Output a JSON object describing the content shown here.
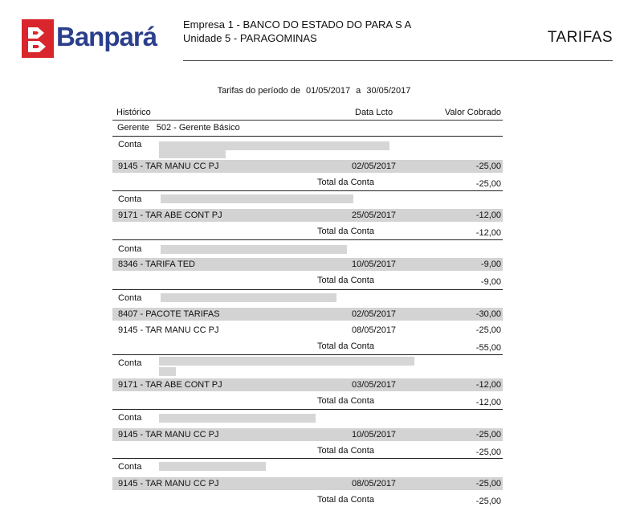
{
  "header": {
    "brand_name": "Banpará",
    "company_label": "Empresa 1",
    "company_name": "BANCO DO ESTADO DO PARA S A",
    "unit_label": "Unidade 5",
    "unit_name": "PARAGOMINAS",
    "report_title": "TARIFAS"
  },
  "period": {
    "prefix": "Tarifas do período de",
    "start": "01/05/2017",
    "connector": "a",
    "end": "30/05/2017"
  },
  "columns": {
    "historico": "Histórico",
    "data_lcto": "Data Lcto",
    "valor_cobrado": "Valor Cobrado"
  },
  "gerente": {
    "label": "Gerente",
    "value": "502 - Gerente Básico"
  },
  "account_label": "Conta",
  "total_label": "Total da Conta",
  "accounts": [
    {
      "transactions": [
        {
          "code": "9145 - TAR MANU CC PJ",
          "date": "02/05/2017",
          "value": "-25,00"
        }
      ],
      "total": "-25,00"
    },
    {
      "transactions": [
        {
          "code": "9171 - TAR ABE CONT PJ",
          "date": "25/05/2017",
          "value": "-12,00"
        }
      ],
      "total": "-12,00"
    },
    {
      "transactions": [
        {
          "code": "8346 - TARIFA TED",
          "date": "10/05/2017",
          "value": "-9,00"
        }
      ],
      "total": "-9,00"
    },
    {
      "transactions": [
        {
          "code": "8407 - PACOTE TARIFAS",
          "date": "02/05/2017",
          "value": "-30,00"
        },
        {
          "code": "9145 - TAR MANU CC PJ",
          "date": "08/05/2017",
          "value": "-25,00"
        }
      ],
      "total": "-55,00"
    },
    {
      "transactions": [
        {
          "code": "9171 - TAR ABE CONT PJ",
          "date": "03/05/2017",
          "value": "-12,00"
        }
      ],
      "total": "-12,00"
    },
    {
      "transactions": [
        {
          "code": "9145 - TAR MANU CC PJ",
          "date": "10/05/2017",
          "value": "-25,00"
        }
      ],
      "total": "-25,00"
    },
    {
      "transactions": [
        {
          "code": "9145 - TAR MANU CC PJ",
          "date": "08/05/2017",
          "value": "-25,00"
        }
      ],
      "total": "-25,00"
    }
  ]
}
